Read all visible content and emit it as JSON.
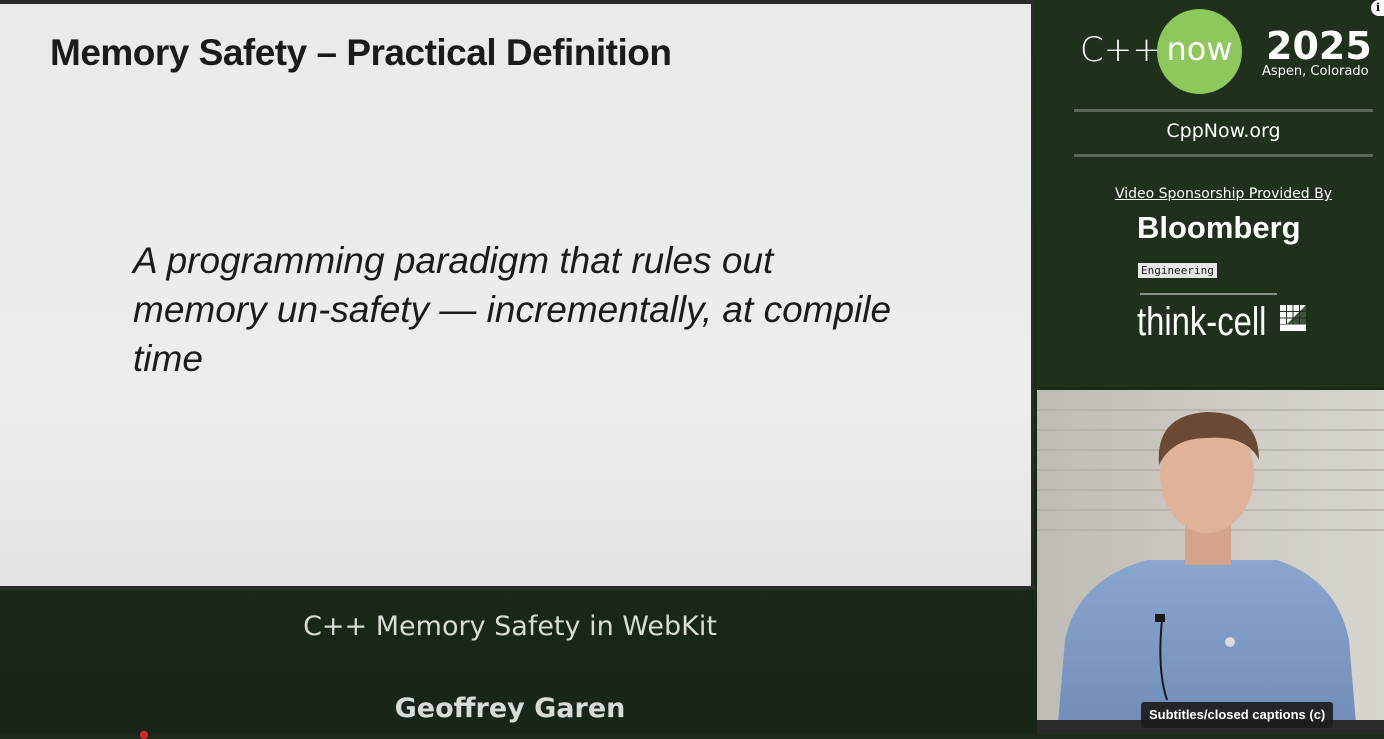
{
  "slide": {
    "title": "Memory Safety – Practical Definition",
    "quote": "A programming paradigm that rules out memory un-safety — incrementally, at compile time"
  },
  "branding": {
    "cpp": "C++",
    "now": "now",
    "year": "2025",
    "location": "Aspen, Colorado",
    "site": "CppNow.org",
    "sponsor_label": "Video Sponsorship Provided By",
    "bloomberg": "Bloomberg",
    "engineering": "Engineering",
    "thinkcell": "think-cell",
    "accent_green": "#8ec75c"
  },
  "talk": {
    "title": "C++ Memory Safety in WebKit",
    "speaker": "Geoffrey Garen"
  },
  "player": {
    "captions_tooltip": "Subtitles/closed captions (c)",
    "info_icon": "i"
  }
}
